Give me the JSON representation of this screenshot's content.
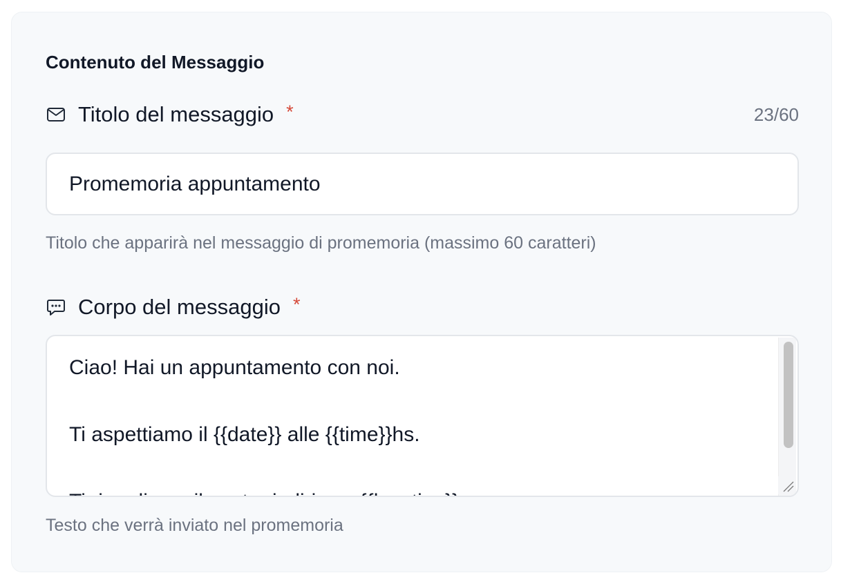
{
  "section": {
    "title": "Contenuto del Messaggio"
  },
  "title_field": {
    "icon": "mail-icon",
    "label": "Titolo del messaggio",
    "required_mark": "*",
    "counter": "23/60",
    "value": "Promemoria appuntamento",
    "help": "Titolo che apparirà nel messaggio di promemoria (massimo 60 caratteri)"
  },
  "body_field": {
    "icon": "message-icon",
    "label": "Corpo del messaggio",
    "required_mark": "*",
    "value": "Ciao! Hai un appuntamento con noi.\n\nTi aspettiamo il {{date}} alle {{time}}hs.\n\nTi ricordiamo il nostro indirizzo: {{location}}",
    "help": "Testo che verrà inviato nel promemoria"
  },
  "colors": {
    "required": "#d54a3a",
    "card_background": "#f7f9fb",
    "help_text": "#6b7280"
  }
}
